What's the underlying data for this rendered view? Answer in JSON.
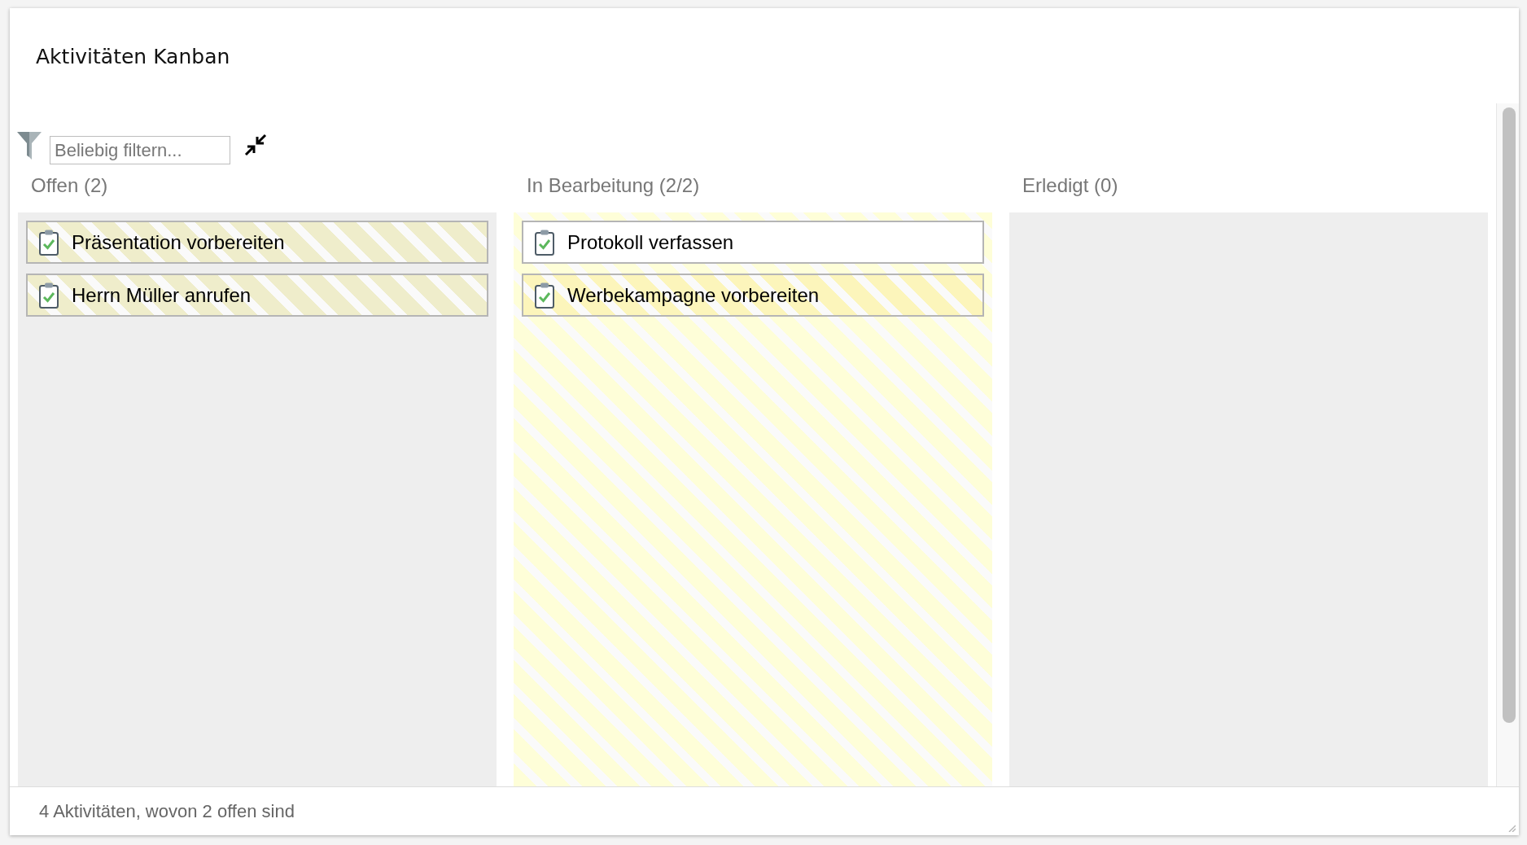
{
  "window": {
    "title": "Aktivitäten Kanban"
  },
  "toolbar": {
    "filter": {
      "placeholder": "Beliebig filtern..."
    }
  },
  "columns": [
    {
      "title": "Offen (2)",
      "highlighted": false,
      "cards": [
        {
          "title": "Präsentation vorbereiten",
          "striped": true,
          "color": "#efedcb"
        },
        {
          "title": "Herrn Müller anrufen",
          "striped": true,
          "color": "#efedcb"
        }
      ]
    },
    {
      "title": "In Bearbeitung (2/2)",
      "highlighted": true,
      "cards": [
        {
          "title": "Protokoll verfassen",
          "striped": false
        },
        {
          "title": "Werbekampagne vorbereiten",
          "striped": true,
          "color": "#fcf5bb"
        }
      ]
    },
    {
      "title": "Erledigt (0)",
      "highlighted": false
    }
  ],
  "status_bar": {
    "text": "4 Aktivitäten, wovon 2 offen sind"
  }
}
